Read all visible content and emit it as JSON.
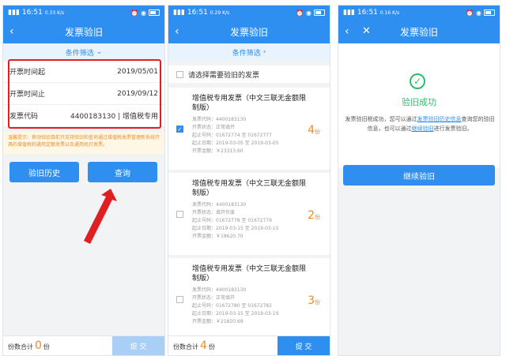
{
  "status": {
    "time": "16:51",
    "speed1": "0.33 K/s",
    "speed2": "0.29 K/s",
    "speed3": "0.16 K/s"
  },
  "panel1": {
    "title": "发票验旧",
    "filter": "条件筛选",
    "fields": [
      {
        "label": "开票时间起",
        "value": "2019/05/01"
      },
      {
        "label": "开票时间止",
        "value": "2019/09/12"
      },
      {
        "label": "发票代码",
        "value": "4400183130 | 增值税专用"
      }
    ],
    "tip": "温馨提示：移动验旧目前只支持验旧和查询通过增值税发票管理新系统开具的增值税和通用定额发票以及通用机打发票。",
    "history_btn": "验旧历史",
    "query_btn": "查询",
    "count_label": "份数合计",
    "count": "0",
    "count_unit": "份",
    "submit": "提 交"
  },
  "panel2": {
    "title": "发票验旧",
    "filter": "条件筛选",
    "select_all": "请选择需要验旧的发票",
    "cards": [
      {
        "title": "增值税专用发票（中文三联无金额限制版）",
        "code": "发票代码：4400183130",
        "state": "开票状态：正常填开",
        "nums": "起止号码：01672774 至 01672777",
        "dates": "起止日期：2019-03-05 至 2019-03-05",
        "amount": "开票金额：￥23313.60",
        "qty": "4",
        "unit": "份",
        "checked": true
      },
      {
        "title": "增值税专用发票（中文三联无金额限制版）",
        "code": "发票代码：4400183130",
        "state": "开票状态：填开作废",
        "nums": "起止号码：01672778 至 01672779",
        "dates": "起止日期：2019-03-15 至 2019-03-15",
        "amount": "开票金额：￥18620.70",
        "qty": "2",
        "unit": "份",
        "checked": false
      },
      {
        "title": "增值税专用发票（中文三联无金额限制版）",
        "code": "发票代码：4400183130",
        "state": "开票状态：正常填开",
        "nums": "起止号码：01672780 至 01672782",
        "dates": "起止日期：2019-03-15 至 2019-03-19",
        "amount": "开票金额：￥21820.69",
        "qty": "3",
        "unit": "份",
        "checked": false
      }
    ],
    "count_label": "份数合计",
    "count": "4",
    "count_unit": "份",
    "submit": "提 交"
  },
  "panel3": {
    "title": "发票验旧",
    "success": "验旧成功",
    "desc_a": "发票验旧税成功，您可以通过",
    "desc_link1": "发票验旧历史信息",
    "desc_b": "查询您的验旧信息，也可以通过",
    "desc_link2": "继续验旧",
    "desc_c": "进行发票验旧。",
    "continue_btn": "继续验旧"
  },
  "colors": {
    "primary": "#2f8ff0",
    "success": "#2bbd6d",
    "highlight": "#e02020",
    "count": "#f08a24"
  }
}
